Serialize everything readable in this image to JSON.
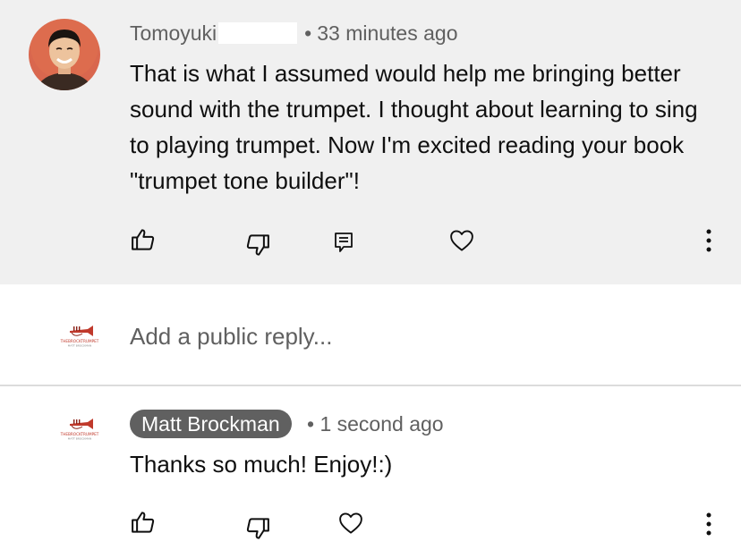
{
  "top_comment": {
    "author": "Tomoyuki",
    "time": "33 minutes ago",
    "text": "That is what I assumed would help me bringing better sound with the trumpet. I thought about learning to sing to playing trumpet. Now I'm excited reading your book \"trumpet tone builder\"!"
  },
  "reply_box": {
    "placeholder": "Add a public reply..."
  },
  "reply_comment": {
    "author": "Matt Brockman",
    "time": "1 second ago",
    "text": "Thanks so much! Enjoy!:)"
  },
  "logo": {
    "line1": "THEBROCKTRUMPET",
    "line2": "MATT BROCKMAN"
  },
  "icons": {
    "like": "thumbs-up-icon",
    "dislike": "thumbs-down-icon",
    "reply": "comment-icon",
    "heart": "heart-icon",
    "more": "more-vertical-icon"
  },
  "colors": {
    "highlight_bg": "#f0f0f0",
    "pill_bg": "#606060",
    "meta_text": "#606060",
    "body_text": "#0f0f0f"
  }
}
